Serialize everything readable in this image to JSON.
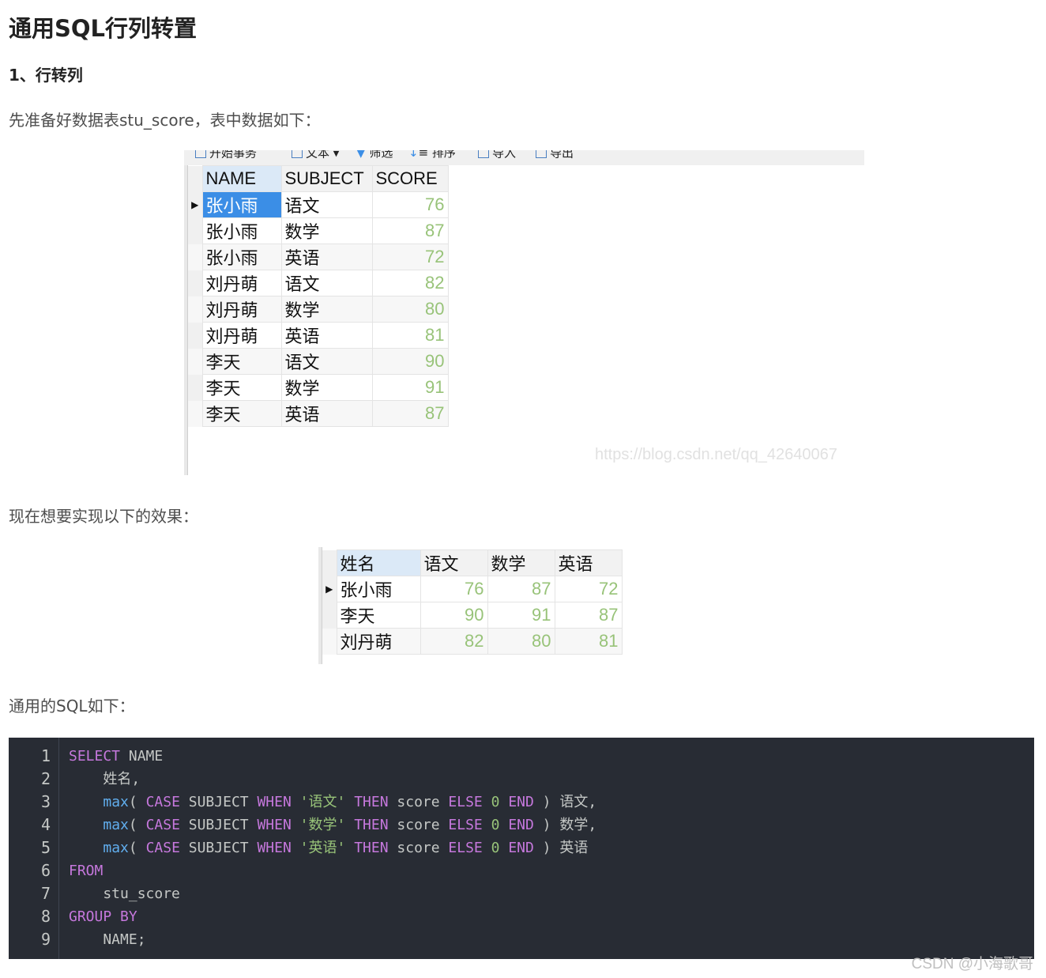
{
  "title": "通用SQL行列转置",
  "section": "1、行转列",
  "para1": "先准备好数据表stu_score，表中数据如下：",
  "para2": "现在想要实现以下的效果：",
  "para3": "通用的SQL如下：",
  "toolbar": {
    "begin_tx": "开始事务",
    "text": "文本",
    "filter": "筛选",
    "sort": "排序",
    "import": "导入",
    "export": "导出"
  },
  "watermark": "https://blog.csdn.net/qq_42640067",
  "table1": {
    "headers": [
      "NAME",
      "SUBJECT",
      "SCORE"
    ],
    "rows": [
      [
        "张小雨",
        "语文",
        "76"
      ],
      [
        "张小雨",
        "数学",
        "87"
      ],
      [
        "张小雨",
        "英语",
        "72"
      ],
      [
        "刘丹萌",
        "语文",
        "82"
      ],
      [
        "刘丹萌",
        "数学",
        "80"
      ],
      [
        "刘丹萌",
        "英语",
        "81"
      ],
      [
        "李天",
        "语文",
        "90"
      ],
      [
        "李天",
        "数学",
        "91"
      ],
      [
        "李天",
        "英语",
        "87"
      ]
    ]
  },
  "table2": {
    "headers": [
      "姓名",
      "语文",
      "数学",
      "英语"
    ],
    "rows": [
      [
        "张小雨",
        "76",
        "87",
        "72"
      ],
      [
        "李天",
        "90",
        "91",
        "87"
      ],
      [
        "刘丹萌",
        "82",
        "80",
        "81"
      ]
    ]
  },
  "code": {
    "line_numbers": [
      "1",
      "2",
      "3",
      "4",
      "5",
      "6",
      "7",
      "8",
      "9"
    ],
    "l1": {
      "kw": "SELECT",
      "rest": " NAME"
    },
    "l2": {
      "text": "    姓名,"
    },
    "l3": {
      "fn": "max",
      "open": "( ",
      "case": "CASE",
      "subj": " SUBJECT ",
      "when": "WHEN",
      "str": "'语文'",
      "then": "THEN",
      "score": " score ",
      "else": "ELSE",
      "zero": "0",
      "end": "END",
      "alias": " ) 语文,"
    },
    "l4": {
      "fn": "max",
      "open": "( ",
      "case": "CASE",
      "subj": " SUBJECT ",
      "when": "WHEN",
      "str": "'数学'",
      "then": "THEN",
      "score": " score ",
      "else": "ELSE",
      "zero": "0",
      "end": "END",
      "alias": " ) 数学,"
    },
    "l5": {
      "fn": "max",
      "open": "( ",
      "case": "CASE",
      "subj": " SUBJECT ",
      "when": "WHEN",
      "str": "'英语'",
      "then": "THEN",
      "score": " score ",
      "else": "ELSE",
      "zero": "0",
      "end": "END",
      "alias": " ) 英语"
    },
    "l6": {
      "kw": "FROM"
    },
    "l7": {
      "text": "    stu_score"
    },
    "l8": {
      "kw": "GROUP BY"
    },
    "l9": {
      "text": "    NAME;"
    }
  },
  "footer": "CSDN @小海歌哥"
}
